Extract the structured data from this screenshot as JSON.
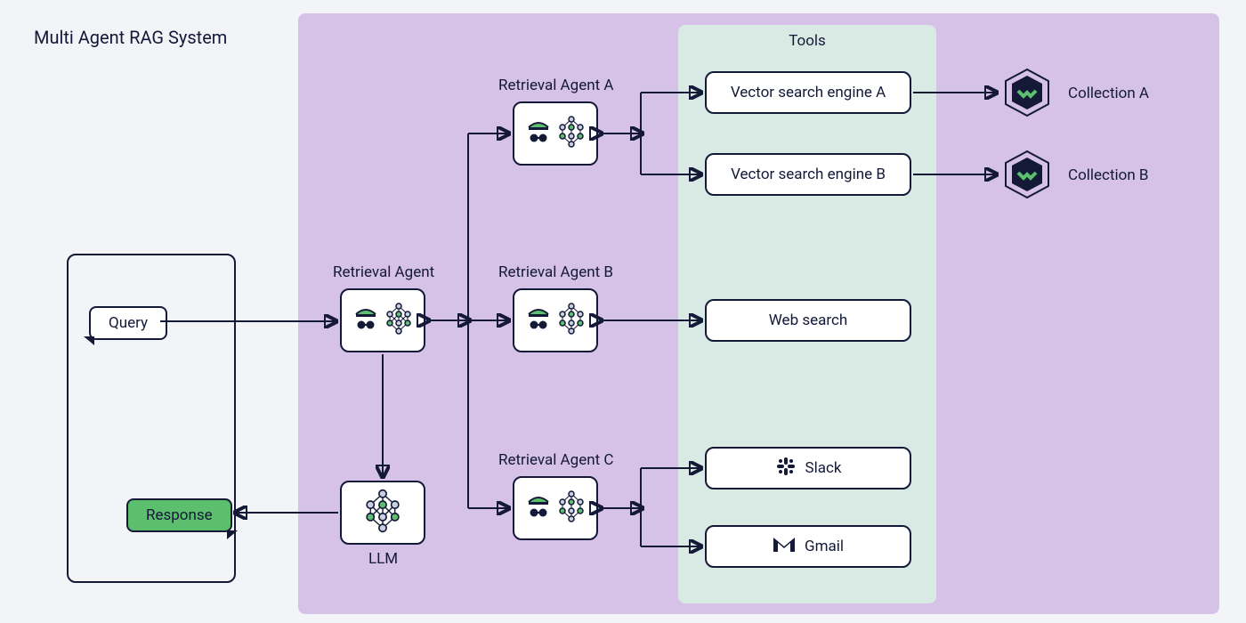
{
  "title": "Multi Agent RAG System",
  "tools_label": "Tools",
  "user": {
    "query_label": "Query",
    "response_label": "Response"
  },
  "llm_label": "LLM",
  "retrieval_agent": {
    "label": "Retrieval Agent"
  },
  "agents": {
    "a": {
      "label": "Retrieval Agent A"
    },
    "b": {
      "label": "Retrieval Agent B"
    },
    "c": {
      "label": "Retrieval Agent C"
    }
  },
  "tools": {
    "vector_a": "Vector search engine A",
    "vector_b": "Vector search engine B",
    "web_search": "Web search",
    "slack": "Slack",
    "gmail": "Gmail"
  },
  "collections": {
    "a": "Collection A",
    "b": "Collection B"
  }
}
